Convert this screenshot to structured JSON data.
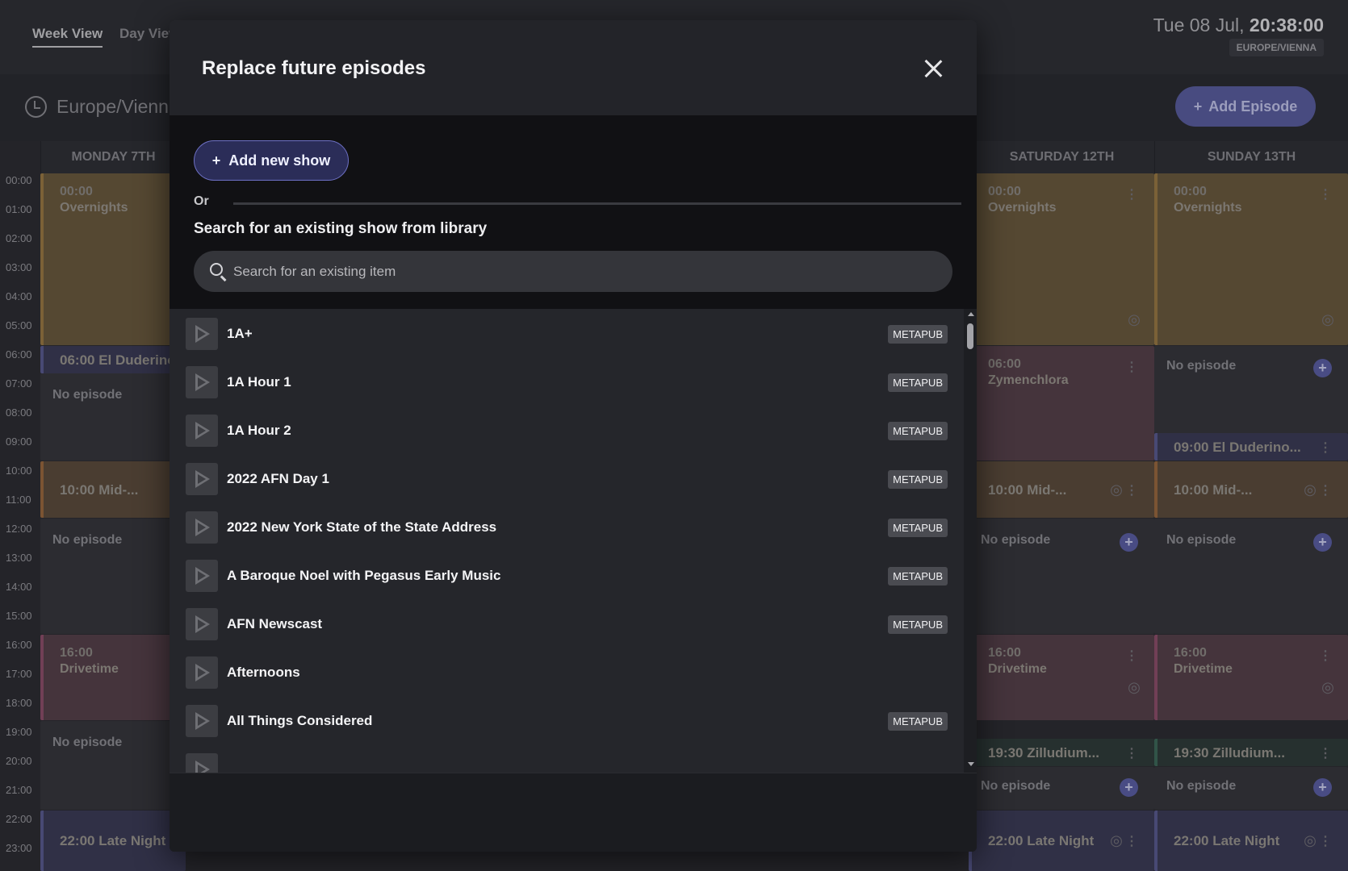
{
  "topbar": {
    "tabs": [
      "Week View",
      "Day View"
    ],
    "date": "Tue 08 Jul,",
    "time": "20:38:00",
    "timezone_badge": "EUROPE/VIENNA"
  },
  "subbar": {
    "timezone_label": "Europe/Vienna",
    "add_episode_label": "Add Episode"
  },
  "calendar": {
    "times": [
      "00:00",
      "01:00",
      "02:00",
      "03:00",
      "04:00",
      "05:00",
      "06:00",
      "07:00",
      "08:00",
      "09:00",
      "10:00",
      "11:00",
      "12:00",
      "13:00",
      "14:00",
      "15:00",
      "16:00",
      "17:00",
      "18:00",
      "19:00",
      "20:00",
      "21:00",
      "22:00",
      "23:00"
    ],
    "days": [
      "MONDAY 7TH",
      "SATURDAY 12TH",
      "SUNDAY 13TH"
    ],
    "monday": {
      "b1_time": "00:00",
      "b1_name": "Overnights",
      "b2": "06:00  El Duderino",
      "b3": "No episode",
      "b4": "10:00  Mid-...",
      "b5": "No episode",
      "b6_time": "16:00",
      "b6_name": "Drivetime",
      "b7": "No episode",
      "b8": "22:00  Late Night"
    },
    "saturday": {
      "b1_time": "00:00",
      "b1_name": "Overnights",
      "b2_time": "06:00",
      "b2_name": "Zymenchlora",
      "b3": "10:00  Mid-...",
      "b4": "No episode",
      "b5_time": "16:00",
      "b5_name": "Drivetime",
      "b6": "19:30  Zilludium...",
      "b7": "No episode",
      "b8": "22:00  Late Night"
    },
    "sunday": {
      "b1_time": "00:00",
      "b1_name": "Overnights",
      "b2": "No episode",
      "b3": "09:00  El Duderino...",
      "b4": "10:00  Mid-...",
      "b5": "No episode",
      "b6_time": "16:00",
      "b6_name": "Drivetime",
      "b7": "19:30  Zilludium...",
      "b8": "No episode",
      "b9": "22:00  Late Night"
    }
  },
  "modal": {
    "title": "Replace future episodes",
    "add_show_label": "Add new show",
    "or_label": "Or",
    "search_heading": "Search for an existing show from library",
    "search_placeholder": "Search for an existing item",
    "items": [
      {
        "title": "1A+",
        "badge": "METAPUB"
      },
      {
        "title": "1A Hour 1",
        "badge": "METAPUB"
      },
      {
        "title": "1A Hour 2",
        "badge": "METAPUB"
      },
      {
        "title": "2022 AFN Day 1",
        "badge": "METAPUB"
      },
      {
        "title": "2022 New York State of the State Address",
        "badge": "METAPUB"
      },
      {
        "title": "A Baroque Noel with Pegasus Early Music",
        "badge": "METAPUB"
      },
      {
        "title": "AFN Newscast",
        "badge": "METAPUB"
      },
      {
        "title": "Afternoons",
        "badge": ""
      },
      {
        "title": "All Things Considered",
        "badge": "METAPUB"
      }
    ]
  }
}
